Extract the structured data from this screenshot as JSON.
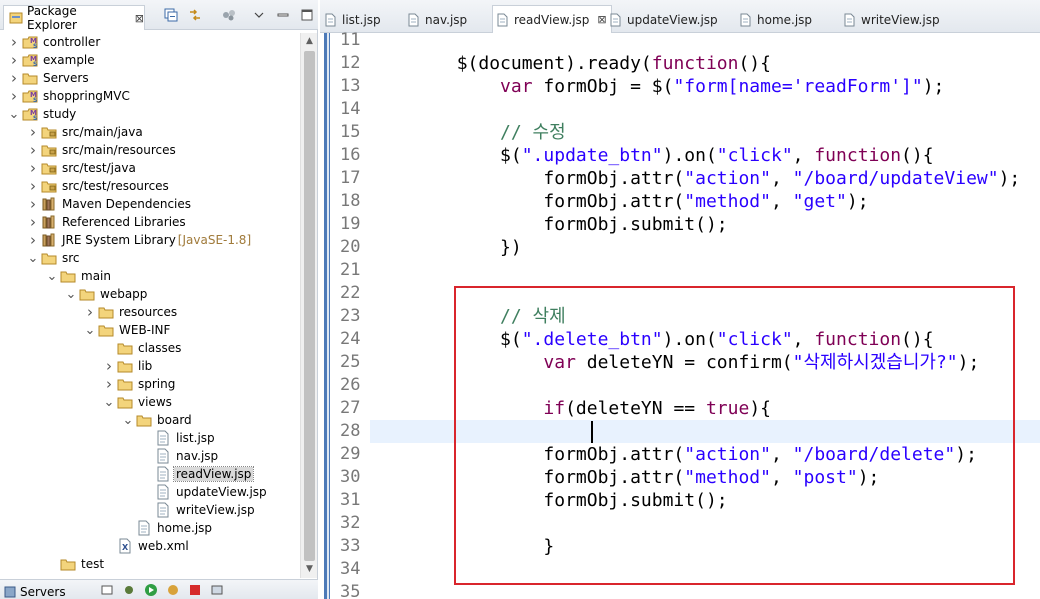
{
  "explorer": {
    "tab_label": "Package Explorer",
    "tab_close": "⊠",
    "tree": [
      {
        "depth": 0,
        "arrow": "right",
        "icon": "maven-project-icon",
        "label": "controller"
      },
      {
        "depth": 0,
        "arrow": "right",
        "icon": "maven-project-icon",
        "label": "example"
      },
      {
        "depth": 0,
        "arrow": "right",
        "icon": "folder-icon",
        "label": "Servers"
      },
      {
        "depth": 0,
        "arrow": "right",
        "icon": "maven-project-icon",
        "label": "shoppringMVC"
      },
      {
        "depth": 0,
        "arrow": "down",
        "icon": "maven-project-icon",
        "label": "study"
      },
      {
        "depth": 1,
        "arrow": "right",
        "icon": "package-folder-icon",
        "label": "src/main/java"
      },
      {
        "depth": 1,
        "arrow": "right",
        "icon": "package-folder-icon",
        "label": "src/main/resources"
      },
      {
        "depth": 1,
        "arrow": "right",
        "icon": "package-folder-icon",
        "label": "src/test/java"
      },
      {
        "depth": 1,
        "arrow": "right",
        "icon": "package-folder-icon",
        "label": "src/test/resources"
      },
      {
        "depth": 1,
        "arrow": "right",
        "icon": "library-icon",
        "label": "Maven Dependencies"
      },
      {
        "depth": 1,
        "arrow": "right",
        "icon": "library-icon",
        "label": "Referenced Libraries"
      },
      {
        "depth": 1,
        "arrow": "right",
        "icon": "library-icon",
        "label": "JRE System Library",
        "sub": "[JavaSE-1.8]"
      },
      {
        "depth": 1,
        "arrow": "down",
        "icon": "folder-icon",
        "label": "src"
      },
      {
        "depth": 2,
        "arrow": "down",
        "icon": "folder-icon",
        "label": "main"
      },
      {
        "depth": 3,
        "arrow": "down",
        "icon": "folder-icon",
        "label": "webapp"
      },
      {
        "depth": 4,
        "arrow": "right",
        "icon": "folder-icon",
        "label": "resources"
      },
      {
        "depth": 4,
        "arrow": "down",
        "icon": "folder-icon",
        "label": "WEB-INF"
      },
      {
        "depth": 5,
        "arrow": "none",
        "icon": "folder-icon",
        "label": "classes"
      },
      {
        "depth": 5,
        "arrow": "right",
        "icon": "folder-icon",
        "label": "lib"
      },
      {
        "depth": 5,
        "arrow": "right",
        "icon": "folder-icon",
        "label": "spring"
      },
      {
        "depth": 5,
        "arrow": "down",
        "icon": "folder-icon",
        "label": "views"
      },
      {
        "depth": 6,
        "arrow": "down",
        "icon": "folder-icon",
        "label": "board"
      },
      {
        "depth": 7,
        "arrow": "none",
        "icon": "jsp-file-icon",
        "label": "list.jsp"
      },
      {
        "depth": 7,
        "arrow": "none",
        "icon": "jsp-file-icon",
        "label": "nav.jsp"
      },
      {
        "depth": 7,
        "arrow": "none",
        "icon": "jsp-file-icon",
        "label": "readView.jsp",
        "selected": true
      },
      {
        "depth": 7,
        "arrow": "none",
        "icon": "jsp-file-icon",
        "label": "updateView.jsp"
      },
      {
        "depth": 7,
        "arrow": "none",
        "icon": "jsp-file-icon",
        "label": "writeView.jsp"
      },
      {
        "depth": 6,
        "arrow": "none",
        "icon": "jsp-file-icon",
        "label": "home.jsp"
      },
      {
        "depth": 5,
        "arrow": "none",
        "icon": "xml-file-icon",
        "label": "web.xml"
      },
      {
        "depth": 2,
        "arrow": "none",
        "icon": "folder-icon",
        "label": "test"
      }
    ]
  },
  "servers": {
    "tab_label": "Servers"
  },
  "editor": {
    "tabs": [
      {
        "label": "list.jsp",
        "active": false
      },
      {
        "label": "nav.jsp",
        "active": false
      },
      {
        "label": "readView.jsp",
        "active": true
      },
      {
        "label": "updateView.jsp",
        "active": false
      },
      {
        "label": "home.jsp",
        "active": false
      },
      {
        "label": "writeView.jsp",
        "active": false
      }
    ],
    "active_close": "⊠",
    "current_line": 28,
    "lines": [
      {
        "n": "11",
        "tokens": []
      },
      {
        "n": "12",
        "tokens": [
          [
            "pl",
            "        $(document).ready("
          ],
          [
            "kw",
            "function"
          ],
          [
            "pl",
            "(){"
          ]
        ]
      },
      {
        "n": "13",
        "tokens": [
          [
            "pl",
            "            "
          ],
          [
            "kw",
            "var"
          ],
          [
            "pl",
            " formObj = $("
          ],
          [
            "str",
            "\"form[name='readForm']\""
          ],
          [
            "pl",
            ");"
          ]
        ]
      },
      {
        "n": "14",
        "tokens": []
      },
      {
        "n": "15",
        "tokens": [
          [
            "pl",
            "            "
          ],
          [
            "cmt",
            "// 수정"
          ]
        ]
      },
      {
        "n": "16",
        "tokens": [
          [
            "pl",
            "            $("
          ],
          [
            "str",
            "\".update_btn\""
          ],
          [
            "pl",
            ").on("
          ],
          [
            "str",
            "\"click\""
          ],
          [
            "pl",
            ", "
          ],
          [
            "kw",
            "function"
          ],
          [
            "pl",
            "(){"
          ]
        ]
      },
      {
        "n": "17",
        "tokens": [
          [
            "pl",
            "                formObj.attr("
          ],
          [
            "str",
            "\"action\""
          ],
          [
            "pl",
            ", "
          ],
          [
            "str",
            "\"/board/updateView\""
          ],
          [
            "pl",
            ");"
          ]
        ]
      },
      {
        "n": "18",
        "tokens": [
          [
            "pl",
            "                formObj.attr("
          ],
          [
            "str",
            "\"method\""
          ],
          [
            "pl",
            ", "
          ],
          [
            "str",
            "\"get\""
          ],
          [
            "pl",
            ");"
          ]
        ]
      },
      {
        "n": "19",
        "tokens": [
          [
            "pl",
            "                formObj.submit();"
          ]
        ]
      },
      {
        "n": "20",
        "tokens": [
          [
            "pl",
            "            })"
          ]
        ]
      },
      {
        "n": "21",
        "tokens": []
      },
      {
        "n": "22",
        "tokens": []
      },
      {
        "n": "23",
        "tokens": [
          [
            "pl",
            "            "
          ],
          [
            "cmt",
            "// 삭제"
          ]
        ]
      },
      {
        "n": "24",
        "tokens": [
          [
            "pl",
            "            $("
          ],
          [
            "str",
            "\".delete_btn\""
          ],
          [
            "pl",
            ").on("
          ],
          [
            "str",
            "\"click\""
          ],
          [
            "pl",
            ", "
          ],
          [
            "kw",
            "function"
          ],
          [
            "pl",
            "(){"
          ]
        ]
      },
      {
        "n": "25",
        "tokens": [
          [
            "pl",
            "                "
          ],
          [
            "kw",
            "var"
          ],
          [
            "pl",
            " deleteYN = confirm("
          ],
          [
            "str",
            "\"삭제하시겠습니가?\""
          ],
          [
            "pl",
            ");"
          ]
        ]
      },
      {
        "n": "26",
        "tokens": []
      },
      {
        "n": "27",
        "tokens": [
          [
            "pl",
            "                "
          ],
          [
            "kw",
            "if"
          ],
          [
            "pl",
            "(deleteYN == "
          ],
          [
            "kw",
            "true"
          ],
          [
            "pl",
            "){"
          ]
        ]
      },
      {
        "n": "28",
        "tokens": []
      },
      {
        "n": "29",
        "tokens": [
          [
            "pl",
            "                formObj.attr("
          ],
          [
            "str",
            "\"action\""
          ],
          [
            "pl",
            ", "
          ],
          [
            "str",
            "\"/board/delete\""
          ],
          [
            "pl",
            ");"
          ]
        ]
      },
      {
        "n": "30",
        "tokens": [
          [
            "pl",
            "                formObj.attr("
          ],
          [
            "str",
            "\"method\""
          ],
          [
            "pl",
            ", "
          ],
          [
            "str",
            "\"post\""
          ],
          [
            "pl",
            ");"
          ]
        ]
      },
      {
        "n": "31",
        "tokens": [
          [
            "pl",
            "                formObj.submit();"
          ]
        ]
      },
      {
        "n": "32",
        "tokens": []
      },
      {
        "n": "33",
        "tokens": [
          [
            "pl",
            "                }"
          ]
        ]
      },
      {
        "n": "34",
        "tokens": []
      },
      {
        "n": "35",
        "tokens": []
      }
    ]
  },
  "colors": {
    "keyword": "#7f0055",
    "string": "#2a00ff",
    "comment": "#3f7f5f",
    "line_number": "#787878",
    "current_line": "#e8f2fe",
    "highlight_box": "#d9252c",
    "selection": "#d9d9d9"
  }
}
